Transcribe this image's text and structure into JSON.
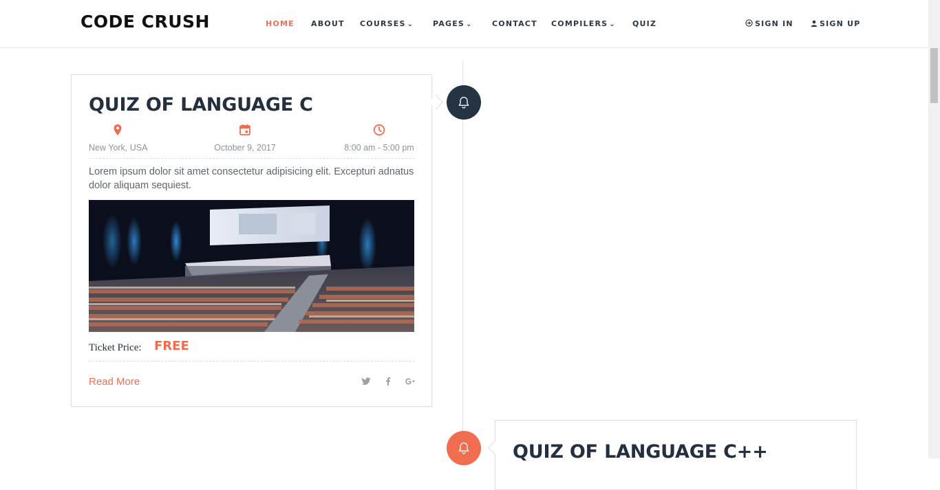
{
  "brand": {
    "name": "CODE CRUSH"
  },
  "nav": {
    "items": [
      {
        "label": "HOME",
        "active": true,
        "has_dropdown": false
      },
      {
        "label": "ABOUT",
        "active": false,
        "has_dropdown": false
      },
      {
        "label": "COURSES",
        "active": false,
        "has_dropdown": true
      },
      {
        "label": "PAGES",
        "active": false,
        "has_dropdown": true
      },
      {
        "label": "CONTACT",
        "active": false,
        "has_dropdown": false
      },
      {
        "label": "COMPILERS",
        "active": false,
        "has_dropdown": true
      },
      {
        "label": "QUIZ",
        "active": false,
        "has_dropdown": false
      }
    ],
    "caret": "⌄"
  },
  "auth": {
    "sign_in": "SIGN IN",
    "sign_up": "SIGN UP",
    "sign_in_icon": "sign-in-icon",
    "sign_up_icon": "user-icon"
  },
  "events": [
    {
      "title": "QUIZ OF LANGUAGE C",
      "location": "New York, USA",
      "date": "October 9, 2017",
      "time": "8:00 am - 5:00 pm",
      "description": "Lorem ipsum dolor sit amet consectetur adipisicing elit. Excepturi adnatus dolor aliquam sequiest.",
      "ticket_label": "Ticket Price:",
      "ticket_price": "FREE",
      "read_more": "Read More",
      "bell_color": "#243443"
    },
    {
      "title": "QUIZ OF LANGUAGE C++",
      "bell_color": "#f06d50"
    }
  ],
  "colors": {
    "accent": "#f06d50",
    "dark": "#243443",
    "muted": "#8c939a"
  }
}
